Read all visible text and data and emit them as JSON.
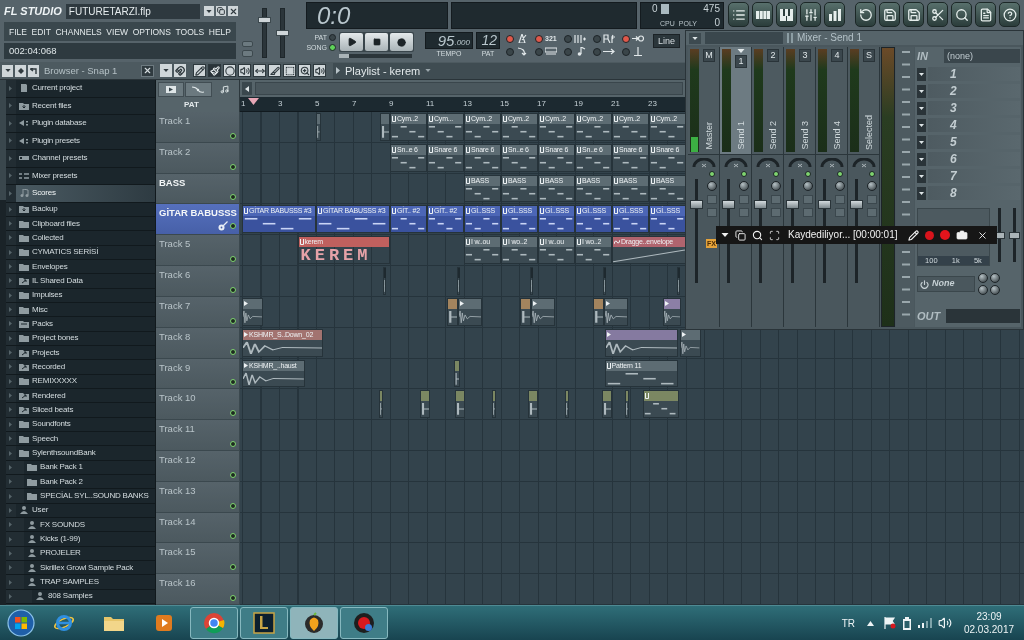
{
  "app": {
    "logo": "FL STUDIO",
    "file_name": "FUTURETARZI.flp",
    "menu": [
      "FILE",
      "EDIT",
      "CHANNELS",
      "VIEW",
      "OPTIONS",
      "TOOLS",
      "HELP"
    ],
    "hint": "002:04:068"
  },
  "master_sliders": [
    {
      "level": 0.8
    },
    {
      "level": 0.5
    }
  ],
  "transport": {
    "time": "0:0",
    "modes": [
      {
        "label": "PAT",
        "selected": false
      },
      {
        "label": "SONG",
        "selected": true
      }
    ],
    "buttons": [
      {
        "kind": "play"
      },
      {
        "kind": "stop"
      },
      {
        "kind": "record"
      }
    ],
    "song_position": {
      "level": 0
    },
    "tempo": "95",
    "tempo_fraction": ".000",
    "tempo_label": "TEMPO",
    "pattern": "12",
    "pattern_label": "PAT",
    "toggles": [
      {
        "kind": "metronome",
        "on": true
      },
      {
        "kind": "countdown",
        "label": "321",
        "on": true
      },
      {
        "kind": "step",
        "on": false
      },
      {
        "kind": "loop-record",
        "on": false
      },
      {
        "kind": "blend",
        "on": true
      },
      {
        "kind": "typing",
        "on": false
      },
      {
        "kind": "wait",
        "on": false
      },
      {
        "kind": "note",
        "on": false
      },
      {
        "kind": "arrow",
        "on": false
      },
      {
        "kind": "punch",
        "on": false
      }
    ],
    "snap": "Line"
  },
  "monitor": {
    "cpu": "0",
    "cpu_label": "CPU",
    "poly_label": "POLY",
    "memory": "475",
    "poly": "0"
  },
  "toolbar": [
    {
      "kind": "playlist"
    },
    {
      "kind": "step-sequencer"
    },
    {
      "kind": "piano-roll"
    },
    {
      "kind": "mixer"
    },
    {
      "kind": "browser"
    },
    {
      "kind": "undo"
    },
    {
      "kind": "save-new"
    },
    {
      "kind": "save"
    },
    {
      "kind": "cut"
    },
    {
      "kind": "search"
    },
    {
      "kind": "document"
    },
    {
      "kind": "help"
    }
  ],
  "browser": {
    "title": "Browser - Snap 1",
    "shortcuts": [
      {
        "label": "Current project",
        "kind": "project",
        "selected": false
      },
      {
        "label": "Recent files",
        "kind": "recent",
        "selected": false
      },
      {
        "label": "Plugin database",
        "kind": "plugin",
        "selected": false
      },
      {
        "label": "Plugin presets",
        "kind": "plugin",
        "selected": false
      },
      {
        "label": "Channel presets",
        "kind": "channel",
        "selected": false
      },
      {
        "label": "Mixer presets",
        "kind": "mixer",
        "selected": false
      },
      {
        "label": "Scores",
        "kind": "score",
        "selected": true
      }
    ],
    "folders": [
      {
        "label": "Backup",
        "kind": "recent",
        "selected": false
      },
      {
        "label": "Clipboard files",
        "kind": "folder",
        "selected": false
      },
      {
        "label": "Collected",
        "kind": "folder",
        "selected": false
      },
      {
        "label": "CYMATICS SERİSİ",
        "kind": "folder",
        "selected": false
      },
      {
        "label": "Envelopes",
        "kind": "folder",
        "selected": false
      },
      {
        "label": "IL Shared Data",
        "kind": "linked",
        "selected": false
      },
      {
        "label": "Impulses",
        "kind": "folder",
        "selected": false
      },
      {
        "label": "Misc",
        "kind": "folder",
        "selected": false
      },
      {
        "label": "Packs",
        "kind": "pack",
        "selected": false
      },
      {
        "label": "Project bones",
        "kind": "folder",
        "selected": false
      },
      {
        "label": "Projects",
        "kind": "linked",
        "selected": false
      },
      {
        "label": "Recorded",
        "kind": "linked",
        "selected": false
      },
      {
        "label": "REMIXXXXX",
        "kind": "folder",
        "selected": false
      },
      {
        "label": "Rendered",
        "kind": "linked",
        "selected": false
      },
      {
        "label": "Sliced beats",
        "kind": "linked",
        "selected": false
      },
      {
        "label": "Soundfonts",
        "kind": "folder",
        "selected": false
      },
      {
        "label": "Speech",
        "kind": "folder",
        "selected": false
      },
      {
        "label": "SylenthsoundBank",
        "kind": "folder",
        "selected": false,
        "children": [
          {
            "label": "Bank Pack 1",
            "kind": "folder",
            "selected": false
          },
          {
            "label": "Bank Pack 2",
            "kind": "folder",
            "selected": false
          },
          {
            "label": "SPECİAL SYL..SOUND BANKS",
            "kind": "folder",
            "selected": false
          }
        ]
      },
      {
        "label": "User",
        "kind": "user",
        "selected": false,
        "children": [
          {
            "label": "FX SOUNDS",
            "kind": "user",
            "selected": false
          },
          {
            "label": "Kicks (1-99)",
            "kind": "user",
            "selected": false
          },
          {
            "label": "PROJELER",
            "kind": "user",
            "selected": false
          },
          {
            "label": "Skrillex Growl Sample Pack",
            "kind": "user",
            "selected": false
          },
          {
            "label": "TRAP SAMPLES",
            "kind": "user",
            "selected": false,
            "children": [
              {
                "label": "808 Samples",
                "kind": "user",
                "selected": false
              }
            ]
          }
        ]
      }
    ]
  },
  "playlist": {
    "title": "Playlist - kerem",
    "tools": [
      {
        "kind": "draw",
        "selected": false
      },
      {
        "kind": "paint",
        "selected": true
      },
      {
        "kind": "delete",
        "selected": false
      },
      {
        "kind": "mute",
        "selected": false
      },
      {
        "kind": "slip",
        "selected": false
      },
      {
        "kind": "slice",
        "selected": false
      },
      {
        "kind": "select",
        "selected": false
      },
      {
        "kind": "zoom",
        "selected": false
      },
      {
        "kind": "playback",
        "selected": false
      }
    ],
    "tabs": [
      {
        "kind": "pattern",
        "selected": false
      },
      {
        "kind": "automation",
        "selected": false
      },
      {
        "kind": "note",
        "selected": true
      }
    ],
    "filter": "PAT",
    "ruler": [
      "1",
      "3",
      "5",
      "7",
      "9",
      "11",
      "13",
      "15",
      "17",
      "19",
      "21",
      "23"
    ],
    "tracks": [
      {
        "name": "Track 1",
        "kind": "track",
        "dimmed": true,
        "selected": false,
        "muted": false,
        "clips": [
          {
            "kind": "pattern"
          },
          {
            "kind": "automation"
          },
          {
            "kind": "pattern",
            "label": "Cym..2"
          },
          {
            "kind": "pattern",
            "label": "Cym..."
          },
          {
            "kind": "pattern",
            "label": "Cym..2"
          },
          {
            "kind": "pattern",
            "label": "Cym..2"
          },
          {
            "kind": "pattern",
            "label": "Cym..2"
          },
          {
            "kind": "pattern",
            "label": "Cym..2"
          },
          {
            "kind": "pattern",
            "label": "Cym..2"
          },
          {
            "kind": "pattern",
            "label": "Cym..2"
          }
        ]
      },
      {
        "name": "Track 2",
        "kind": "track",
        "dimmed": true,
        "selected": false,
        "muted": false,
        "clips": [
          {
            "kind": "pattern",
            "label": "Sn..e 6"
          },
          {
            "kind": "pattern",
            "label": "Snare 6"
          },
          {
            "kind": "pattern",
            "label": "Snare 6"
          },
          {
            "kind": "pattern",
            "label": "Sn..e 6"
          },
          {
            "kind": "pattern",
            "label": "Snare 6"
          },
          {
            "kind": "pattern",
            "label": "Sn..e 6"
          },
          {
            "kind": "pattern",
            "label": "Snare 6"
          },
          {
            "kind": "pattern",
            "label": "Snare 6"
          }
        ]
      },
      {
        "name": "BASS",
        "kind": "track",
        "dimmed": false,
        "selected": false,
        "muted": false,
        "clips": [
          {
            "kind": "pattern",
            "label": "BASS"
          },
          {
            "kind": "pattern",
            "label": "BASS"
          },
          {
            "kind": "pattern",
            "label": "BASS"
          },
          {
            "kind": "pattern",
            "label": "BASS"
          },
          {
            "kind": "pattern",
            "label": "BASS"
          },
          {
            "kind": "pattern",
            "label": "BASS"
          }
        ]
      },
      {
        "name": "GİTAR BABUSSS",
        "kind": "instrument",
        "dimmed": false,
        "selected": true,
        "muted": false,
        "clips": [
          {
            "kind": "pattern",
            "label": "GİTAR BABUSSS #3"
          },
          {
            "kind": "pattern",
            "label": "GİTAR BABUSSS #3"
          },
          {
            "kind": "pattern",
            "label": "GİT.. #2"
          },
          {
            "kind": "pattern",
            "label": "GİT.. #2"
          },
          {
            "kind": "pattern",
            "label": "Gİ..SSS"
          },
          {
            "kind": "pattern",
            "label": "Gİ..SSS"
          },
          {
            "kind": "pattern",
            "label": "Gİ..SSS"
          },
          {
            "kind": "pattern",
            "label": "Gİ..SSS"
          },
          {
            "kind": "pattern",
            "label": "Gİ..SSS"
          },
          {
            "kind": "pattern",
            "label": "Gİ..SSS"
          }
        ]
      },
      {
        "name": "Track 5",
        "kind": "track",
        "dimmed": true,
        "selected": false,
        "muted": false,
        "clips": [
          {
            "kind": "pattern",
            "label": "kerem",
            "content": "KEREM",
            "color": "#c0605e"
          },
          {
            "kind": "pattern",
            "label": "I w..ou"
          },
          {
            "kind": "pattern",
            "label": "I wo..2"
          },
          {
            "kind": "pattern",
            "label": "I w..ou"
          },
          {
            "kind": "pattern",
            "label": "I wo..2"
          },
          {
            "kind": "automation",
            "label": "Dragge..envelope",
            "color": "#b0646e"
          }
        ]
      },
      {
        "name": "Track 6",
        "kind": "track",
        "dimmed": true,
        "selected": false,
        "muted": false,
        "clips": [
          {
            "kind": "pattern",
            "color": "#1e292f"
          },
          {
            "kind": "pattern",
            "color": "#1e292f"
          },
          {
            "kind": "pattern",
            "color": "#1e292f"
          },
          {
            "kind": "pattern",
            "color": "#1e292f"
          },
          {
            "kind": "pattern",
            "color": "#1e292f"
          }
        ]
      },
      {
        "name": "Track 7",
        "kind": "track",
        "dimmed": true,
        "selected": false,
        "muted": false,
        "clips": [
          {
            "kind": "audio"
          },
          {
            "kind": "audio",
            "color": "#a3845e"
          },
          {
            "kind": "audio"
          },
          {
            "kind": "audio",
            "color": "#a3845e"
          },
          {
            "kind": "audio"
          },
          {
            "kind": "audio",
            "color": "#a3845e"
          },
          {
            "kind": "audio"
          },
          {
            "kind": "audio",
            "color": "#8c7fa6"
          }
        ]
      },
      {
        "name": "Track 8",
        "kind": "track",
        "dimmed": true,
        "selected": false,
        "muted": false,
        "clips": [
          {
            "kind": "audio",
            "label": "KSHMR_S..Down_02",
            "color": "#a27370"
          },
          {
            "kind": "audio",
            "color": "#857aa0"
          },
          {
            "kind": "audio"
          }
        ]
      },
      {
        "name": "Track 9",
        "kind": "track",
        "dimmed": true,
        "selected": false,
        "muted": false,
        "clips": [
          {
            "kind": "audio",
            "label": "KSHMR_..haust"
          },
          {
            "kind": "pattern",
            "color": "#7b8762"
          },
          {
            "kind": "pattern",
            "label": "Pattern 11"
          }
        ]
      },
      {
        "name": "Track 10",
        "kind": "track",
        "dimmed": true,
        "selected": false,
        "muted": false,
        "clips": [
          {
            "kind": "pattern",
            "color": "#7b8762"
          },
          {
            "kind": "pattern",
            "color": "#7b8762"
          },
          {
            "kind": "pattern",
            "color": "#7b8762"
          },
          {
            "kind": "pattern",
            "color": "#7b8762"
          },
          {
            "kind": "pattern",
            "color": "#7b8762"
          },
          {
            "kind": "pattern",
            "color": "#7b8762"
          },
          {
            "kind": "pattern",
            "color": "#7b8762"
          },
          {
            "kind": "pattern",
            "color": "#7b8762"
          },
          {
            "kind": "pattern",
            "color": "#7b8762"
          }
        ]
      },
      {
        "name": "Track 11",
        "kind": "track",
        "dimmed": true,
        "selected": false,
        "muted": false
      },
      {
        "name": "Track 12",
        "kind": "track",
        "dimmed": true,
        "selected": false,
        "muted": false
      },
      {
        "name": "Track 13",
        "kind": "track",
        "dimmed": true,
        "selected": false,
        "muted": false
      },
      {
        "name": "Track 14",
        "kind": "track",
        "dimmed": true,
        "selected": false,
        "muted": false
      },
      {
        "name": "Track 15",
        "kind": "track",
        "dimmed": true,
        "selected": false,
        "muted": false
      },
      {
        "name": "Track 16",
        "kind": "track",
        "dimmed": true,
        "selected": false,
        "muted": false
      }
    ]
  },
  "mixer": {
    "title": "Mixer - Send 1",
    "channels": [
      {
        "name": "Master",
        "number": "M",
        "selected": false,
        "meter": {
          "level": 0.15
        },
        "fader": {
          "level": 0.78
        },
        "fx_label": "FX"
      },
      {
        "name": "Send 1",
        "number": "1",
        "selected": true,
        "meter": {
          "level": 0
        },
        "fader": {
          "level": 0.78
        }
      },
      {
        "name": "Send 2",
        "number": "2",
        "selected": false,
        "meter": {
          "level": 0
        },
        "fader": {
          "level": 0.78
        }
      },
      {
        "name": "Send 3",
        "number": "3",
        "selected": false,
        "meter": {
          "level": 0
        },
        "fader": {
          "level": 0.78
        }
      },
      {
        "name": "Send 4",
        "number": "4",
        "selected": false,
        "meter": {
          "level": 0
        },
        "fader": {
          "level": 0.78
        }
      },
      {
        "name": "Selected",
        "number": "S",
        "selected": false,
        "meter": {
          "level": 0
        },
        "fader": {
          "level": 0.78
        }
      }
    ],
    "input_label": "IN",
    "input": "(none)",
    "slots": [
      "1",
      "2",
      "3",
      "4",
      "5",
      "6",
      "7",
      "8"
    ],
    "eq_labels": [
      "100",
      "1k",
      "5k"
    ],
    "eq_sliders": [
      {
        "level": 0.5
      },
      {
        "level": 0.5
      }
    ],
    "output_effect": "None",
    "output_label": "OUT"
  },
  "recorder": {
    "status": "Kaydediliyor... [00:00:01]"
  },
  "taskbar": {
    "apps": [
      {
        "kind": "web",
        "running": false,
        "selected": false
      },
      {
        "kind": "files",
        "running": false,
        "selected": false
      },
      {
        "kind": "media",
        "running": false,
        "selected": false
      },
      {
        "kind": "browser",
        "running": true,
        "selected": false
      },
      {
        "kind": "game",
        "running": true,
        "selected": false
      },
      {
        "kind": "daw",
        "running": true,
        "selected": true
      },
      {
        "kind": "recorder",
        "running": true,
        "selected": false
      }
    ],
    "language": "TR",
    "time": "23:09",
    "date": "02.03.2017"
  }
}
